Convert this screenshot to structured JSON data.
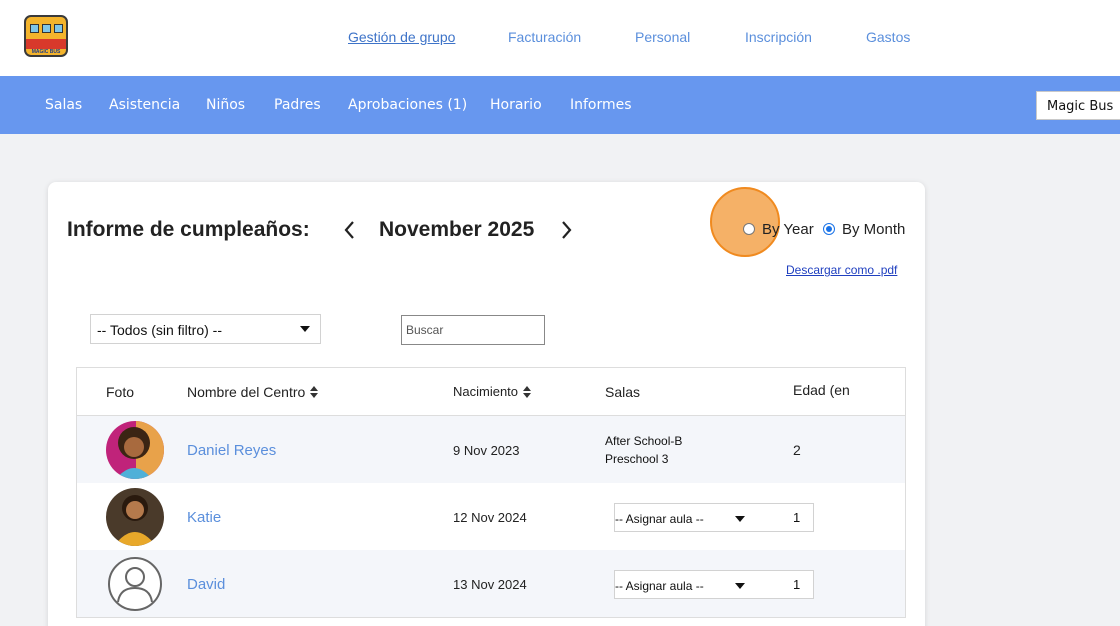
{
  "app": {
    "name": "Magic Bus",
    "logo_text": "MAGIC BUS"
  },
  "top_nav": [
    {
      "label": "Gestión de grupo",
      "active": true
    },
    {
      "label": "Facturación",
      "active": false
    },
    {
      "label": "Personal",
      "active": false
    },
    {
      "label": "Inscripción",
      "active": false
    },
    {
      "label": "Gastos",
      "active": false
    }
  ],
  "main_nav": [
    {
      "label": "Salas"
    },
    {
      "label": "Asistencia"
    },
    {
      "label": "Niños"
    },
    {
      "label": "Padres"
    },
    {
      "label": "Aprobaciones (1)"
    },
    {
      "label": "Horario"
    },
    {
      "label": "Informes"
    }
  ],
  "school_selector": {
    "label": "Magic Bus"
  },
  "report": {
    "title": "Informe de cumpleaños:",
    "period": "November 2025",
    "prev_icon": "chevron-left-icon",
    "next_icon": "chevron-right-icon",
    "view_options": [
      {
        "label": "By Year",
        "selected": false
      },
      {
        "label": "By Month",
        "selected": true
      }
    ],
    "download_link": "Descargar como .pdf"
  },
  "filters": {
    "room_filter": "-- Todos (sin filtro) --",
    "search_placeholder": "Buscar"
  },
  "table": {
    "headers": {
      "photo": "Foto",
      "name": "Nombre del Centro",
      "birth": "Nacimiento",
      "rooms": "Salas",
      "age": "Edad (en"
    },
    "rows": [
      {
        "name": "Daniel Reyes",
        "birth": "9 Nov 2023",
        "rooms": [
          "After School-B",
          "Preschool 3"
        ],
        "assign": null,
        "age": "2",
        "avatar": "photo"
      },
      {
        "name": "Katie",
        "birth": "12 Nov 2024",
        "rooms": [],
        "assign": "-- Asignar aula --",
        "age": "1",
        "avatar": "photo"
      },
      {
        "name": "David",
        "birth": "13 Nov 2024",
        "rooms": [],
        "assign": "-- Asignar aula --",
        "age": "1",
        "avatar": "placeholder-person-icon"
      }
    ]
  },
  "colors": {
    "nav_blue": "#6797ef",
    "link_blue": "#5b8fdc",
    "highlight_orange": "#f3a046"
  }
}
